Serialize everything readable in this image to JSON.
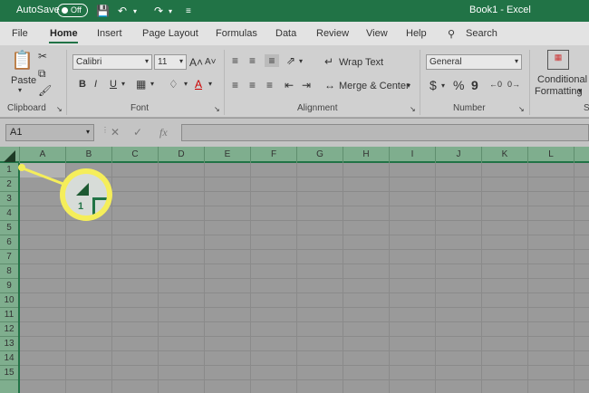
{
  "title_bar": {
    "autosave_label": "AutoSave",
    "autosave_state": "Off",
    "doc_title": "Book1  -  Excel",
    "accent": "#217346"
  },
  "tabs": [
    "File",
    "Home",
    "Insert",
    "Page Layout",
    "Formulas",
    "Data",
    "Review",
    "View",
    "Help"
  ],
  "search_label": "Search",
  "ribbon": {
    "clipboard": {
      "paste": "Paste",
      "label": "Clipboard"
    },
    "font": {
      "font_name": "Calibri",
      "font_size": "11",
      "bold": "B",
      "italic": "I",
      "underline": "U",
      "label": "Font"
    },
    "alignment": {
      "wrap_text": "Wrap Text",
      "merge_center": "Merge & Center",
      "label": "Alignment"
    },
    "number": {
      "format": "General",
      "currency": "$",
      "percent": "%",
      "comma": "9",
      "label": "Number"
    },
    "styles": {
      "conditional_line1": "Conditional",
      "conditional_line2": "Formatting"
    }
  },
  "formula_bar": {
    "name_box": "A1",
    "fx": "fx",
    "formula": ""
  },
  "columns": [
    "A",
    "B",
    "C",
    "D",
    "E",
    "F",
    "G",
    "H",
    "I",
    "J",
    "K",
    "L"
  ],
  "rows": [
    "1",
    "2",
    "3",
    "4",
    "5",
    "6",
    "7",
    "8",
    "9",
    "10",
    "11",
    "12",
    "13",
    "14",
    "15"
  ],
  "callout": {
    "zoom_label": "1",
    "highlight": "#f5ee5a"
  }
}
